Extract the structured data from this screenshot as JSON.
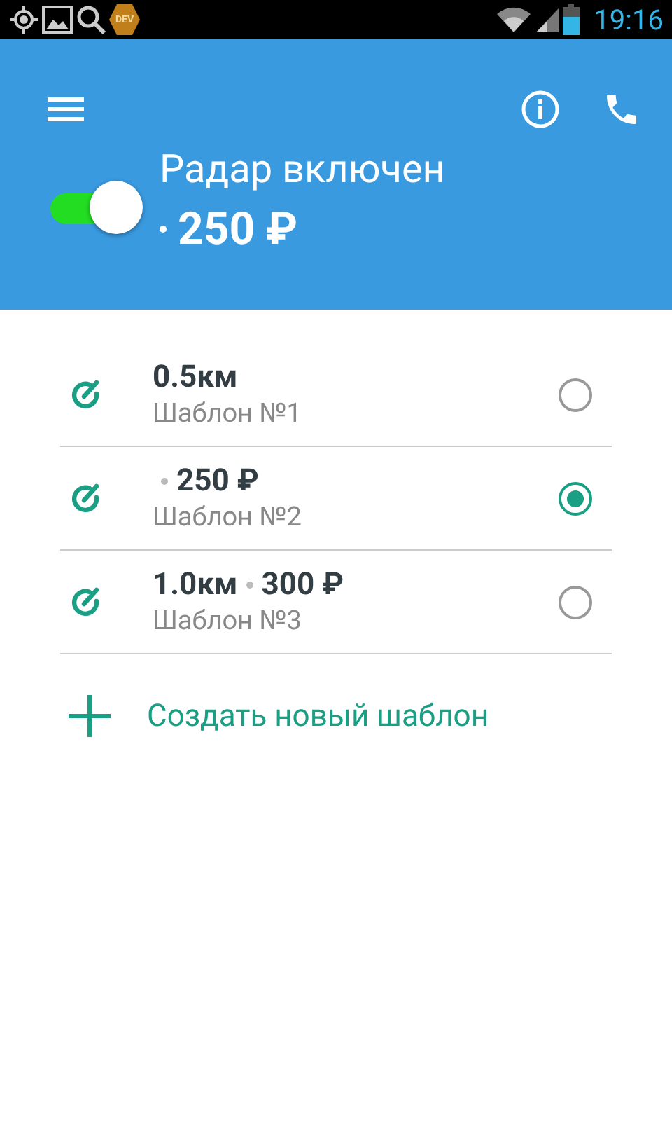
{
  "status_bar": {
    "badge": "DEV",
    "time": "19:16"
  },
  "header": {
    "title": "Радар включен",
    "price": "250 ₽",
    "radar_on": true
  },
  "templates": [
    {
      "distance": "0.5км",
      "name": "Шаблон №1",
      "selected": false
    },
    {
      "price": "250 ₽",
      "name": "Шаблон №2",
      "selected": true
    },
    {
      "distance": "1.0км",
      "price": "300 ₽",
      "name": "Шаблон №3",
      "selected": false
    }
  ],
  "create_button": {
    "label": "Создать новый шаблон"
  }
}
